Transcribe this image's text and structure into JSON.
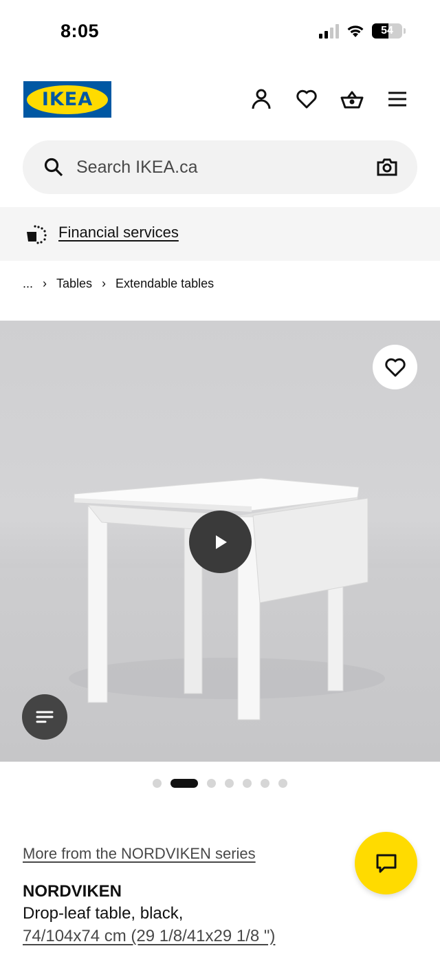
{
  "status": {
    "time": "8:05",
    "battery": "54",
    "battery_level": 0.54
  },
  "header": {
    "logo_text": "IKEA",
    "icons": [
      "account-icon",
      "heart-icon",
      "basket-icon",
      "menu-icon"
    ]
  },
  "search": {
    "placeholder": "Search IKEA.ca",
    "camera_icon": "camera-icon"
  },
  "financial": {
    "label": "Financial services",
    "icon": "piggy-bank-icon"
  },
  "breadcrumb": {
    "ellipsis": "...",
    "items": [
      "Tables",
      "Extendable tables"
    ]
  },
  "gallery": {
    "total_images": 7,
    "active_index": 1,
    "icons": [
      "heart-icon",
      "play-icon",
      "list-icon"
    ]
  },
  "product": {
    "series_link": "More from the NORDVIKEN series",
    "name": "NORDVIKEN",
    "description": "Drop-leaf table, black,",
    "size": "74/104x74 cm (29 1/8/41x29 1/8 \")"
  },
  "colors": {
    "ikea_blue": "#0058a3",
    "ikea_yellow": "#ffdb00"
  }
}
